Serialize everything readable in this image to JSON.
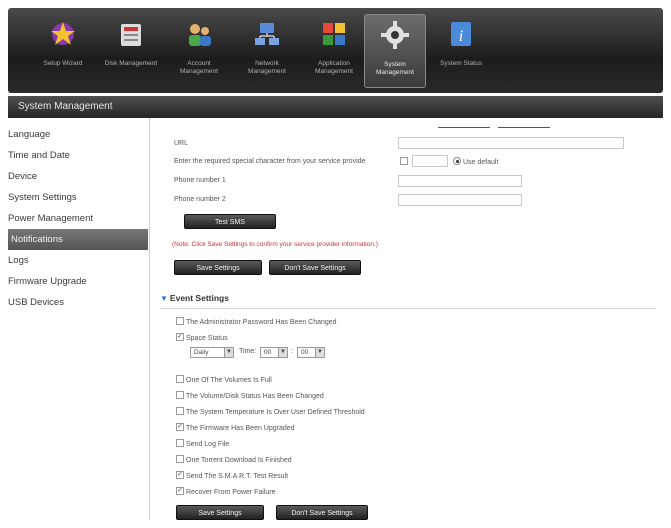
{
  "nav": {
    "items": [
      {
        "label": "Setup Wizard",
        "icon": "wizard-icon"
      },
      {
        "label": "Disk Management",
        "icon": "disk-icon"
      },
      {
        "label": "Account Management",
        "icon": "account-icon"
      },
      {
        "label": "Network Management",
        "icon": "network-icon"
      },
      {
        "label": "Application Management",
        "icon": "application-icon"
      },
      {
        "label": "System Management",
        "icon": "system-gear-icon",
        "active": true
      },
      {
        "label": "System Status",
        "icon": "info-icon"
      }
    ]
  },
  "title": "System Management",
  "sidebar": {
    "items": [
      {
        "label": "Language"
      },
      {
        "label": "Time and Date"
      },
      {
        "label": "Device"
      },
      {
        "label": "System Settings"
      },
      {
        "label": "Power Management"
      },
      {
        "label": "Notifications",
        "active": true
      },
      {
        "label": "Logs"
      },
      {
        "label": "Firmware Upgrade"
      },
      {
        "label": "USB Devices"
      }
    ]
  },
  "sms": {
    "url_label": "URL",
    "special_char_label": "Enter the required special character from your service provide",
    "use_default_label": "Use default",
    "phone1_label": "Phone number 1",
    "phone2_label": "Phone number 2",
    "test_sms_label": "Test SMS",
    "note": "(Note: Click Save Settings to confirm your service provider information.)",
    "save_label": "Save Settings",
    "dont_save_label": "Don't Save Settings"
  },
  "events": {
    "header": "Event Settings",
    "items": [
      {
        "label": "The Administrator Password Has Been Changed",
        "checked": false
      },
      {
        "label": "Space Status",
        "checked": true
      },
      {
        "label": "One Of The Volumes Is Full",
        "checked": false
      },
      {
        "label": "The Volume/Disk Status Has Been Changed",
        "checked": false
      },
      {
        "label": "The System Temperature Is Over User Defined Threshold",
        "checked": false
      },
      {
        "label": "The Firmware Has Been Upgraded",
        "checked": true
      },
      {
        "label": "Send Log File",
        "checked": false
      },
      {
        "label": "One Torrent Download Is Finished",
        "checked": false
      },
      {
        "label": "Send The S.M.A.R.T. Test Result",
        "checked": true
      },
      {
        "label": "Recover From Power Failure",
        "checked": true
      }
    ],
    "schedule": {
      "frequency": "Daily",
      "time_label": "Time:",
      "hour": "00",
      "minute": "00"
    },
    "save_label": "Save Settings",
    "dont_save_label": "Don't Save Settings"
  },
  "colors": {
    "note": "#d03030",
    "accent": "#2a7bd0"
  }
}
